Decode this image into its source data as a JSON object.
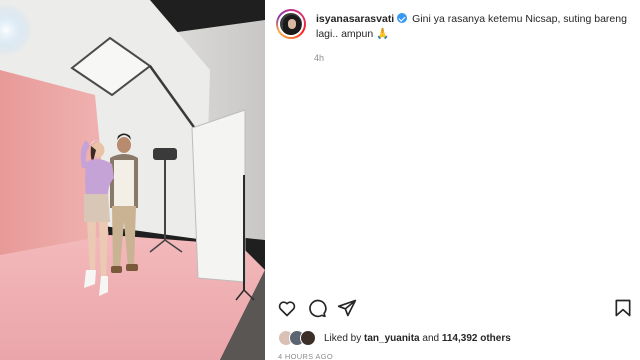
{
  "post": {
    "username": "isyanasarasvati",
    "verified": true,
    "caption": "Gini ya rasanya ketemu Nicsap, suting bareng lagi.. ampun 🙏",
    "time_ago": "4h"
  },
  "likes": {
    "prefix": "Liked by",
    "user": "tan_yuanita",
    "connector": "and",
    "count": "114,392 others"
  },
  "timestamp": "4 HOURS AGO",
  "icons": {
    "like": "heart-icon",
    "comment": "comment-icon",
    "share": "paper-plane-icon",
    "save": "bookmark-icon"
  },
  "colors": {
    "verified_badge": "#3897f0",
    "secondary_text": "#8e8e8e",
    "backdrop_pink": "#e7a3a3"
  }
}
